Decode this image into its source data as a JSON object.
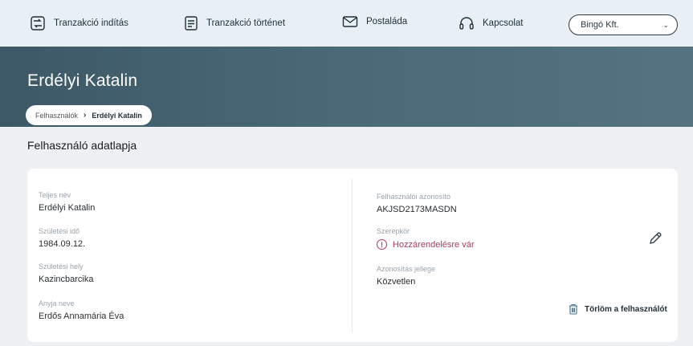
{
  "nav": {
    "items": [
      {
        "label": "Tranzakció indítás",
        "icon": "transaction-start-icon"
      },
      {
        "label": "Tranzakció történet",
        "icon": "document-icon"
      },
      {
        "label": "Postaláda",
        "icon": "mail-icon"
      },
      {
        "label": "Kapcsolat",
        "icon": "headset-icon"
      }
    ],
    "company_select": {
      "value": "Bingó Kft.",
      "icon": "chevron-down-icon"
    }
  },
  "header": {
    "title": "Erdélyi Katalin",
    "breadcrumb": [
      "Felhasználók",
      "Erdélyi Katalin"
    ]
  },
  "section": {
    "title": "Felhasználó adatlapja"
  },
  "details": {
    "full_name": {
      "label": "Teljes név",
      "value": "Erdélyi Katalin"
    },
    "birth_date": {
      "label": "Születési idő",
      "value": "1984.09.12."
    },
    "birth_place": {
      "label": "Születési hely",
      "value": "Kazincbarcika"
    },
    "mother_name": {
      "label": "Anyja neve",
      "value": "Erdős Annamária Éva"
    },
    "user_id": {
      "label": "Felhasználói azonosító",
      "value": "AKJSD2173MASDN"
    },
    "role": {
      "label": "Szerepkör",
      "value": "Hozzárendelésre vár",
      "status_color": "#b03a63",
      "icon": "warning-icon"
    },
    "auth_type": {
      "label": "Azonosítás jellege",
      "value": "Közvetlen"
    }
  },
  "actions": {
    "edit_icon": "pencil-icon",
    "delete_label": "Törlöm a felhasználót",
    "delete_icon": "trash-icon"
  },
  "colors": {
    "banner": "#4a6a78",
    "nav_bg": "#e8f0f6",
    "accent_warning": "#b03a63"
  }
}
